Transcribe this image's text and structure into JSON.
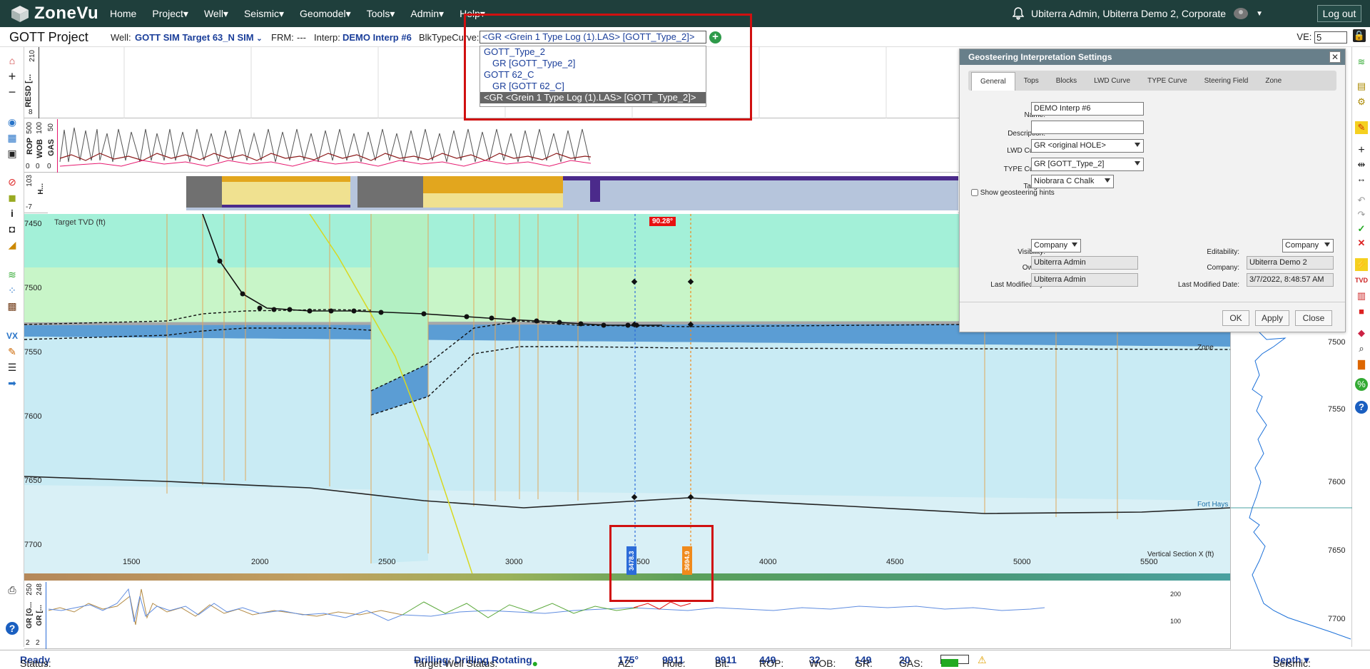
{
  "app": {
    "logo_text": "ZoneVu"
  },
  "menu": [
    "Home",
    "Project▾",
    "Well▾",
    "Seismic▾",
    "Geomodel▾",
    "Tools▾",
    "Admin▾",
    "Help▾"
  ],
  "user": {
    "label": "Ubiterra Admin, Ubiterra Demo 2, Corporate",
    "logout": "Log out"
  },
  "project": {
    "title": "GOTT Project",
    "well_label": "Well:",
    "well_value": "GOTT SIM Target 63_N SIM",
    "frm_label": "FRM:",
    "frm_value": "---",
    "interp_label": "Interp:",
    "interp_value": "DEMO Interp #6",
    "blk_label": "BlkTypeCurve:",
    "blk_value": "<GR <Grein 1 Type Log (1).LAS> [GOTT_Type_2]>",
    "ve_label": "VE:",
    "ve_value": "5"
  },
  "dropdown": [
    {
      "type": "grp",
      "text": "GOTT_Type_2"
    },
    {
      "type": "opt",
      "text": "GR [GOTT_Type_2]"
    },
    {
      "type": "grp",
      "text": "GOTT 62_C"
    },
    {
      "type": "opt",
      "text": "GR [GOTT 62_C]"
    },
    {
      "type": "sel",
      "text": "<GR <Grein 1 Type Log (1).LAS> [GOTT_Type_2]>"
    }
  ],
  "tracks": {
    "resd": {
      "label": "RESD [...",
      "ticks": [
        "210",
        "8"
      ]
    },
    "rop": {
      "labels": [
        "ROP",
        "WOB",
        "GAS"
      ],
      "ticks": [
        "500",
        "0",
        "100",
        "0",
        "50",
        "0"
      ]
    },
    "blk": {
      "ticks": [
        "103",
        "-7"
      ],
      "label": "H..."
    },
    "gr": {
      "labels": [
        "GR [G...",
        "GR [..."
      ],
      "ticks": [
        "250",
        "2",
        "248",
        "2"
      ]
    }
  },
  "section": {
    "title": "Target TVD (ft)",
    "y_ticks": [
      "7450",
      "7500",
      "7550",
      "7600",
      "7650",
      "7700"
    ],
    "x_ticks": [
      "1500",
      "2000",
      "2500",
      "3000",
      "3500",
      "4000",
      "4500",
      "5000",
      "5500"
    ],
    "x_label": "Vertical Section X (ft)",
    "angle_badge": "90.28°",
    "marker_blue": "3478.3",
    "marker_orange": "3694.9",
    "right_ticks": [
      "7500",
      "7550",
      "7600",
      "7650",
      "7700"
    ],
    "zone_label": "Zone",
    "fort_hays": "Fort Hays",
    "gr_ticks": [
      "200",
      "100"
    ]
  },
  "dialog": {
    "title": "Geosteering Interpretation Settings",
    "tabs": [
      "General",
      "Tops",
      "Blocks",
      "LWD Curve",
      "TYPE Curve",
      "Steering Field",
      "Zone"
    ],
    "name_label": "Name:",
    "name_value": "DEMO Interp #6",
    "desc_label": "Description:",
    "desc_value": "",
    "lwd_label": "LWD Curve:",
    "lwd_value": "GR <original HOLE>",
    "type_label": "TYPE Curve:",
    "type_value": "GR [GOTT_Type_2]",
    "target_label": "Target:",
    "target_value": "Niobrara C Chalk",
    "hints_label": "Show geosteering hints",
    "vis_label": "Visibility:",
    "vis_value": "Company",
    "edit_label": "Editability:",
    "edit_value": "Company",
    "owner_label": "Owner:",
    "owner_value": "Ubiterra Admin",
    "company_label": "Company:",
    "company_value": "Ubiterra Demo 2",
    "lmb_label": "Last Modified By:",
    "lmb_value": "Ubiterra Admin",
    "lmd_label": "Last Modified Date:",
    "lmd_value": "3/7/2022, 8:48:57 AM",
    "ok": "OK",
    "apply": "Apply",
    "close": "Close"
  },
  "status": {
    "status_label": "Status:",
    "status_value": "Ready",
    "tws_label": "Target Well Status:",
    "tws_value": "Drilling: Drilling Rotating",
    "az_label": "AZ:",
    "az_value": "175°",
    "hole_label": "Hole:",
    "hole_value": "9911",
    "bit_label": "Bit:",
    "bit_value": "9911",
    "rop_label": "ROP:",
    "rop_value": "449",
    "wob_label": "WOB:",
    "wob_value": "32",
    "gr_label": "GR:",
    "gr_value": "149",
    "gas_label": "GAS:",
    "gas_value": "20",
    "seismic_label": "Seismic:",
    "seismic_value": "Depth ▾"
  },
  "colors": {
    "topbar": "#1f3f3c",
    "accent": "#1a3e9a",
    "highlight_red": "#d01010"
  }
}
